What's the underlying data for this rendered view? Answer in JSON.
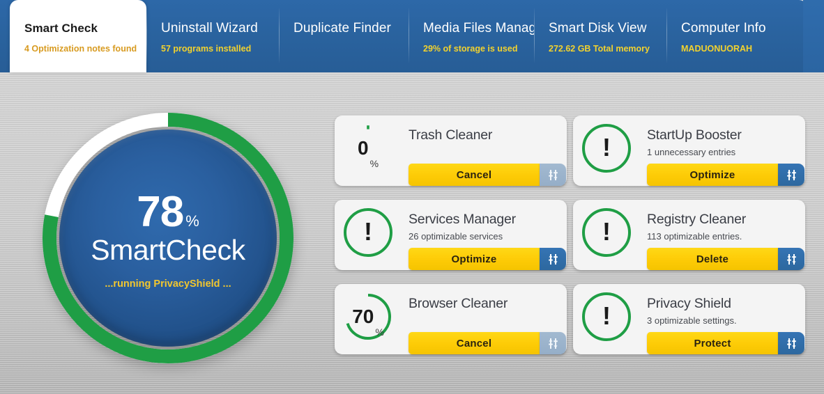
{
  "colors": {
    "tabbar_blue": "#2a639f",
    "accent_yellow": "#fdcb06",
    "ring_green": "#1f9e45",
    "status_yellow": "#f2c72e",
    "gauge_blue": "#2a5f9f"
  },
  "tabs": [
    {
      "title": "Smart Check",
      "subtitle": "4 Optimization notes found",
      "active": true
    },
    {
      "title": "Uninstall Wizard",
      "subtitle": "57 programs installed",
      "active": false
    },
    {
      "title": "Duplicate Finder",
      "subtitle": "",
      "active": false
    },
    {
      "title": "Media Files Manager",
      "subtitle": "29% of storage is used",
      "active": false
    },
    {
      "title": "Smart Disk View",
      "subtitle": "272.62 GB Total memory",
      "active": false
    },
    {
      "title": "Computer Info",
      "subtitle": "MADUONUORAH",
      "active": false
    }
  ],
  "gauge": {
    "percent": "78",
    "percent_sign": "%",
    "label": "SmartCheck",
    "status": "...running PrivacyShield ...",
    "value": 78,
    "max": 100
  },
  "cards": [
    {
      "title": "Trash Cleaner",
      "subtitle": "",
      "icon": "progress-ring-icon",
      "percent": "0",
      "percent_sign": "%",
      "value": 0,
      "action_label": "Cancel",
      "settings_icon": "sliders-icon",
      "settings_style": "light"
    },
    {
      "title": "StartUp Booster",
      "subtitle": "1 unnecessary entries",
      "icon": "alert-circle-icon",
      "percent": "",
      "percent_sign": "",
      "value": null,
      "action_label": "Optimize",
      "settings_icon": "sliders-icon",
      "settings_style": "dark"
    },
    {
      "title": "Services Manager",
      "subtitle": "26 optimizable services",
      "icon": "alert-circle-icon",
      "percent": "",
      "percent_sign": "",
      "value": null,
      "action_label": "Optimize",
      "settings_icon": "sliders-icon",
      "settings_style": "dark"
    },
    {
      "title": "Registry Cleaner",
      "subtitle": "113 optimizable entries.",
      "icon": "alert-circle-icon",
      "percent": "",
      "percent_sign": "",
      "value": null,
      "action_label": "Delete",
      "settings_icon": "sliders-icon",
      "settings_style": "dark"
    },
    {
      "title": "Browser Cleaner",
      "subtitle": "",
      "icon": "progress-ring-icon",
      "percent": "70",
      "percent_sign": "%",
      "value": 70,
      "action_label": "Cancel",
      "settings_icon": "sliders-icon",
      "settings_style": "light"
    },
    {
      "title": "Privacy Shield",
      "subtitle": "3 optimizable settings.",
      "icon": "alert-circle-icon",
      "percent": "",
      "percent_sign": "",
      "value": null,
      "action_label": "Protect",
      "settings_icon": "sliders-icon",
      "settings_style": "dark"
    }
  ],
  "alert_glyph": "!"
}
